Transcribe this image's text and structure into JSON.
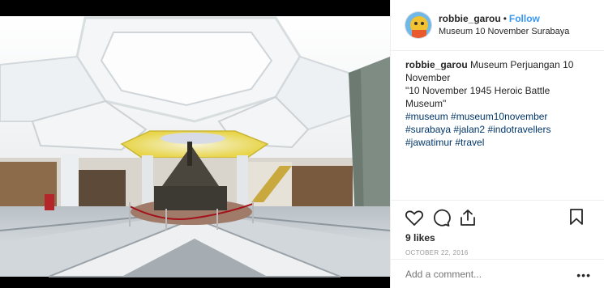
{
  "header": {
    "username": "robbie_garou",
    "separator": "•",
    "follow_label": "Follow",
    "location": "Museum 10 November Surabaya"
  },
  "caption": {
    "username": "robbie_garou",
    "line1": "Museum Perjuangan 10 November",
    "line2": "\"10 November 1945 Heroic Battle Museum\"",
    "hashtags": [
      "#museum",
      "#museum10november",
      "#surabaya",
      "#jalan2",
      "#indotravellers",
      "#jawatimur",
      "#travel"
    ]
  },
  "actions": {
    "likes": "9 likes",
    "date": "OCTOBER 22, 2016"
  },
  "comment": {
    "placeholder": "Add a comment...",
    "more_label": "•••"
  },
  "icons": [
    "heart-icon",
    "comment-icon",
    "share-icon",
    "bookmark-icon"
  ],
  "colors": {
    "link": "#3897f0",
    "hashtag": "#003569",
    "muted": "#999999"
  }
}
